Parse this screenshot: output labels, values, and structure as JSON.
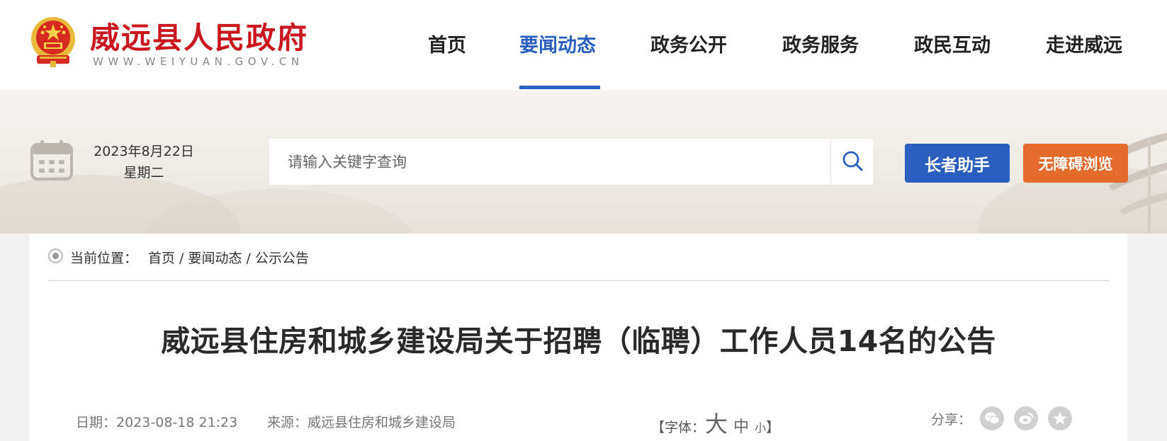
{
  "header": {
    "site_title": "威远县人民政府",
    "site_url": "WWW.WEIYUAN.GOV.CN",
    "nav": [
      {
        "label": "首页"
      },
      {
        "label": "要闻动态"
      },
      {
        "label": "政务公开"
      },
      {
        "label": "政务服务"
      },
      {
        "label": "政民互动"
      },
      {
        "label": "走进威远"
      }
    ],
    "active_nav": "要闻动态"
  },
  "banner": {
    "date": "2023年8月22日",
    "weekday": "星期二",
    "search_placeholder": "请输入关键字查询",
    "elder_label": "长者助手",
    "accessibility_label": "无障碍浏览"
  },
  "breadcrumb": {
    "label": "当前位置：",
    "items": [
      "首页",
      "要闻动态",
      "公示公告"
    ],
    "separator": " / "
  },
  "article": {
    "title": "威远县住房和城乡建设局关于招聘（临聘）工作人员14名的公告",
    "date_label": "日期：",
    "date_value": "2023-08-18 21:23",
    "source_label": "来源：",
    "source_value": "威远县住房和城乡建设局",
    "font_open": "【字体：",
    "font_big": "大",
    "font_mid": "中",
    "font_small": "小",
    "font_close": "】",
    "share_label": "分享："
  },
  "colors": {
    "brand_red": "#c8171e",
    "accent_blue": "#2b5fbf",
    "accent_orange": "#e56b2c"
  },
  "icons": [
    "national-emblem-icon",
    "calendar-icon",
    "search-icon",
    "wechat-icon",
    "weibo-icon",
    "favorite-star-icon"
  ]
}
